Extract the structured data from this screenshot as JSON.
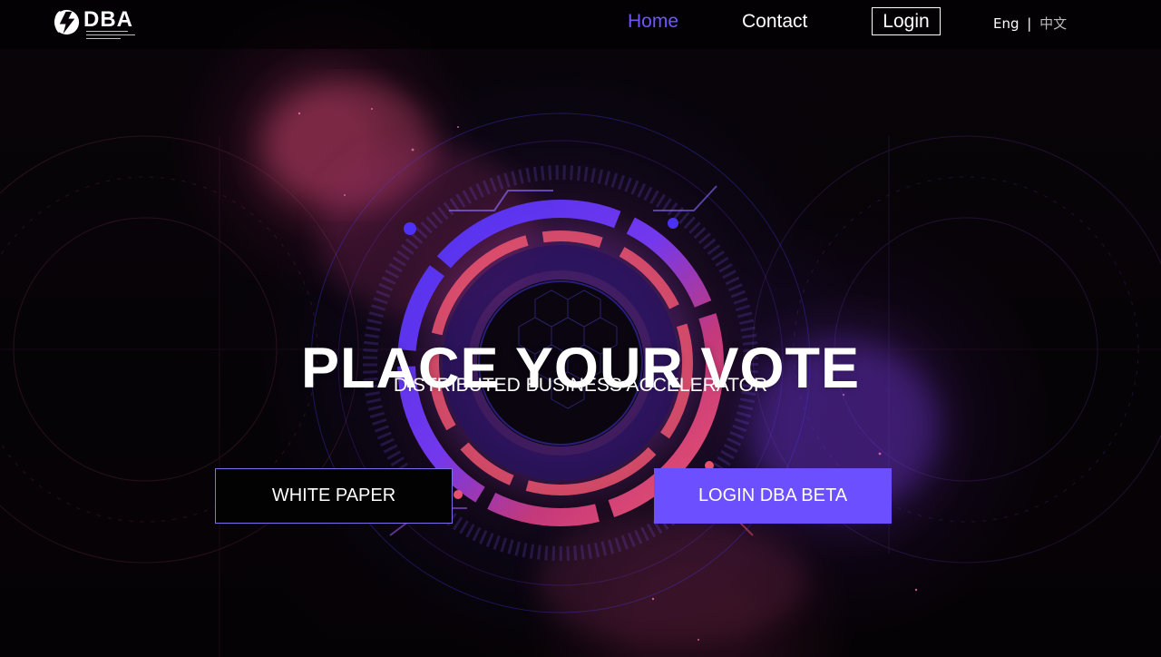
{
  "logo": {
    "text": "DBA",
    "tagline": "DISTRIBUTED BUSINESS ACCELERATOR",
    "icon": "lightning-icon"
  },
  "nav": {
    "home": "Home",
    "contact": "Contact",
    "login": "Login",
    "language_en": "Eng",
    "language_separator": "|",
    "language_cn": "中文"
  },
  "hero": {
    "title": "PLACE YOUR VOTE",
    "subtitle": "DISTRIBUTED BUSINESS ACCELERATOR",
    "white_paper": "WHITE PAPER",
    "login_beta": "LOGIN DBA BETA"
  },
  "colors": {
    "accent": "#6c50ff",
    "home": "#6e56ff",
    "background": "#070309"
  }
}
